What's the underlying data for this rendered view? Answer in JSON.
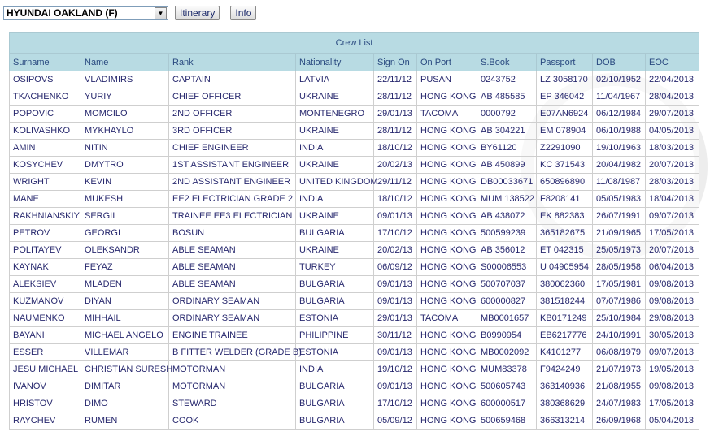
{
  "toolbar": {
    "vessel": "HYUNDAI OAKLAND (F)",
    "itinerary": "Itinerary",
    "info": "Info"
  },
  "table": {
    "title": "Crew List",
    "columns": [
      "Surname",
      "Name",
      "Rank",
      "Nationality",
      "Sign On",
      "On Port",
      "S.Book",
      "Passport",
      "DOB",
      "EOC"
    ],
    "rows": [
      [
        "OSIPOVS",
        "VLADIMIRS",
        "CAPTAIN",
        "LATVIA",
        "22/11/12",
        "PUSAN",
        "0243752",
        "LZ 3058170",
        "02/10/1952",
        "22/04/2013"
      ],
      [
        "TKACHENKO",
        "YURIY",
        "CHIEF OFFICER",
        "UKRAINE",
        "28/11/12",
        "HONG KONG",
        "AB 485585",
        "EP 346042",
        "11/04/1967",
        "28/04/2013"
      ],
      [
        "POPOVIC",
        "MOMCILO",
        "2ND OFFICER",
        "MONTENEGRO",
        "29/01/13",
        "TACOMA",
        "0000792",
        "E07AN6924",
        "06/12/1984",
        "29/07/2013"
      ],
      [
        "KOLIVASHKO",
        "MYKHAYLO",
        "3RD OFFICER",
        "UKRAINE",
        "28/11/12",
        "HONG KONG",
        "AB 304221",
        "EM 078904",
        "06/10/1988",
        "04/05/2013"
      ],
      [
        "AMIN",
        "NITIN",
        "CHIEF ENGINEER",
        "INDIA",
        "18/10/12",
        "HONG KONG",
        "BY61120",
        "Z2291090",
        "19/10/1963",
        "18/03/2013"
      ],
      [
        "KOSYCHEV",
        "DMYTRO",
        "1ST ASSISTANT ENGINEER",
        "UKRAINE",
        "20/02/13",
        "HONG KONG",
        "AB 450899",
        "KC 371543",
        "20/04/1982",
        "20/07/2013"
      ],
      [
        "WRIGHT",
        "KEVIN",
        "2ND ASSISTANT ENGINEER",
        "UNITED KINGDOM",
        "29/11/12",
        "HONG KONG",
        "DB00033671",
        "650896890",
        "11/08/1987",
        "28/03/2013"
      ],
      [
        "MANE",
        "MUKESH",
        "EE2 ELECTRICIAN GRADE 2",
        "INDIA",
        "18/10/12",
        "HONG KONG",
        "MUM 138522",
        "F8208141",
        "05/05/1983",
        "18/04/2013"
      ],
      [
        "RAKHNIANSKIY",
        "SERGII",
        "TRAINEE EE3 ELECTRICIAN",
        "UKRAINE",
        "09/01/13",
        "HONG KONG",
        "AB 438072",
        "EK 882383",
        "26/07/1991",
        "09/07/2013"
      ],
      [
        "PETROV",
        "GEORGI",
        "BOSUN",
        "BULGARIA",
        "17/10/12",
        "HONG KONG",
        "500599239",
        "365182675",
        "21/09/1965",
        "17/05/2013"
      ],
      [
        "POLITAYEV",
        "OLEKSANDR",
        "ABLE SEAMAN",
        "UKRAINE",
        "20/02/13",
        "HONG KONG",
        "AB 356012",
        "ET 042315",
        "25/05/1973",
        "20/07/2013"
      ],
      [
        "KAYNAK",
        "FEYAZ",
        "ABLE SEAMAN",
        "TURKEY",
        "06/09/12",
        "HONG KONG",
        "S00006553",
        "U 04905954",
        "28/05/1958",
        "06/04/2013"
      ],
      [
        "ALEKSIEV",
        "MLADEN",
        "ABLE SEAMAN",
        "BULGARIA",
        "09/01/13",
        "HONG KONG",
        "500707037",
        "380062360",
        "17/05/1981",
        "09/08/2013"
      ],
      [
        "KUZMANOV",
        "DIYAN",
        "ORDINARY SEAMAN",
        "BULGARIA",
        "09/01/13",
        "HONG KONG",
        "600000827",
        "381518244",
        "07/07/1986",
        "09/08/2013"
      ],
      [
        "NAUMENKO",
        "MIHHAIL",
        "ORDINARY SEAMAN",
        "ESTONIA",
        "29/01/13",
        "TACOMA",
        "MB0001657",
        "KB0171249",
        "25/10/1984",
        "29/08/2013"
      ],
      [
        "BAYANI",
        "MICHAEL ANGELO",
        "ENGINE TRAINEE",
        "PHILIPPINE",
        "30/11/12",
        "HONG KONG",
        "B0990954",
        "EB6217776",
        "24/10/1991",
        "30/05/2013"
      ],
      [
        "ESSER",
        "VILLEMAR",
        "B FITTER WELDER (GRADE B)",
        "ESTONIA",
        "09/01/13",
        "HONG KONG",
        "MB0002092",
        "K4101277",
        "06/08/1979",
        "09/07/2013"
      ],
      [
        "JESU MICHAEL",
        "CHRISTIAN SURESH",
        "MOTORMAN",
        "INDIA",
        "19/10/12",
        "HONG KONG",
        "MUM83378",
        "F9424249",
        "21/07/1973",
        "19/05/2013"
      ],
      [
        "IVANOV",
        "DIMITAR",
        "MOTORMAN",
        "BULGARIA",
        "09/01/13",
        "HONG KONG",
        "500605743",
        "363140936",
        "21/08/1955",
        "09/08/2013"
      ],
      [
        "HRISTOV",
        "DIMO",
        "STEWARD",
        "BULGARIA",
        "17/10/12",
        "HONG KONG",
        "600000517",
        "380368629",
        "24/07/1983",
        "17/05/2013"
      ],
      [
        "RAYCHEV",
        "RUMEN",
        "COOK",
        "BULGARIA",
        "05/09/12",
        "HONG KONG",
        "500659468",
        "366313214",
        "26/09/1968",
        "05/04/2013"
      ]
    ]
  }
}
